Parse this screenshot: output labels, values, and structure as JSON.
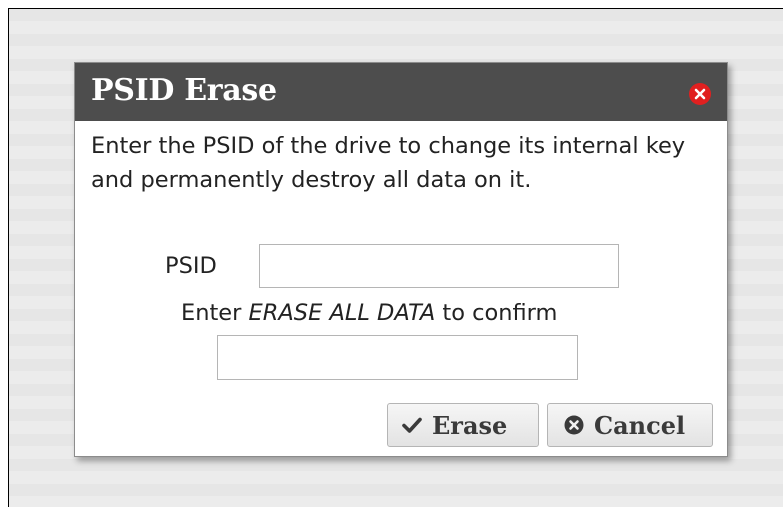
{
  "dialog": {
    "title": "PSID Erase",
    "description": "Enter the PSID of the drive to change its internal key and permanently destroy all data on it.",
    "psid_label": "PSID",
    "psid_value": "",
    "confirm_prefix": "Enter ",
    "confirm_phrase": "ERASE ALL DATA",
    "confirm_suffix": " to confirm",
    "confirm_value": "",
    "erase_label": "Erase",
    "cancel_label": "Cancel",
    "icons": {
      "close": "close-icon",
      "erase": "checkmark-icon",
      "cancel": "cancel-circle-icon"
    },
    "colors": {
      "titlebar": "#4d4d4d",
      "close": "#e02020"
    }
  }
}
